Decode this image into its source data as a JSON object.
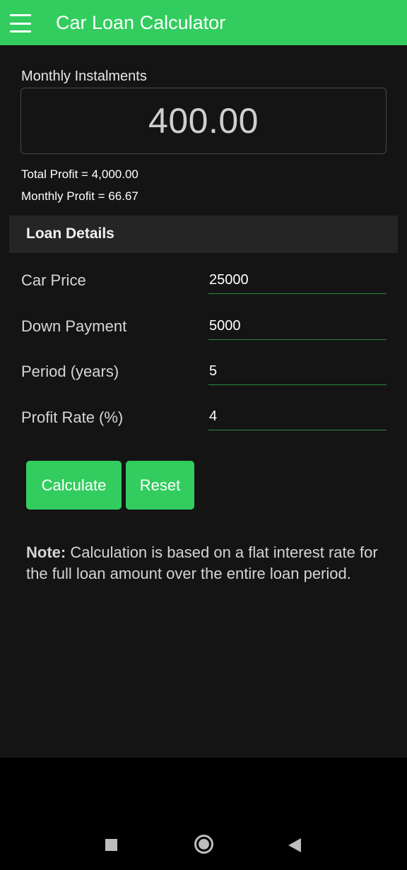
{
  "app_bar": {
    "title": "Car Loan Calculator",
    "menu_icon": "hamburger-menu-icon",
    "color": "#32cd5e"
  },
  "result": {
    "label": "Monthly Instalments",
    "value": "400.00",
    "total_profit": "Total Profit = 4,000.00",
    "monthly_profit": "Monthly Profit = 66.67"
  },
  "loan_details": {
    "title": "Loan Details",
    "fields": [
      {
        "label": "Car Price",
        "value": "25000"
      },
      {
        "label": "Down Payment",
        "value": "5000"
      },
      {
        "label": "Period (years)",
        "value": "5"
      },
      {
        "label": "Profit Rate (%)",
        "value": "4"
      }
    ]
  },
  "buttons": {
    "calculate": "Calculate",
    "reset": "Reset"
  },
  "note": {
    "bold": "Note:",
    "text": " Calculation is based on a flat interest rate for the full loan amount over the entire loan period."
  },
  "nav_bar": {
    "icons": [
      "recent-apps-icon",
      "home-icon",
      "back-icon"
    ]
  }
}
